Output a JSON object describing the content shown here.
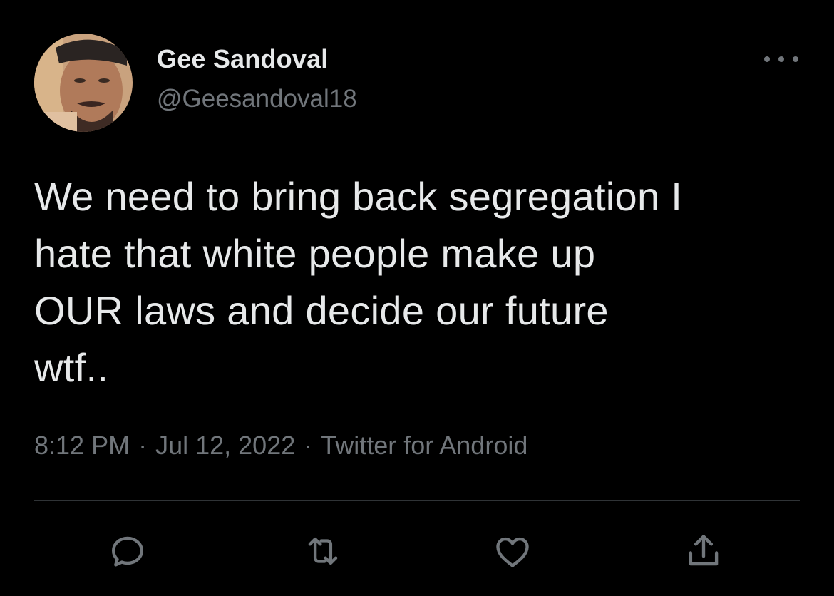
{
  "user": {
    "display_name": "Gee Sandoval",
    "handle": "@Geesandoval18",
    "avatar_icon": "profile-photo"
  },
  "tweet": {
    "lines": [
      "We need to bring back segregation I",
      "hate that white people make up",
      "OUR laws and decide our future",
      "wtf.."
    ]
  },
  "meta": {
    "time": "8:12 PM",
    "separator": "·",
    "date": "Jul 12, 2022",
    "source": "Twitter for Android"
  },
  "actions": [
    {
      "icon": "reply-icon"
    },
    {
      "icon": "retweet-icon"
    },
    {
      "icon": "like-icon"
    },
    {
      "icon": "share-icon"
    }
  ],
  "colors": {
    "background": "#000000",
    "primary_text": "#e7e9ea",
    "secondary_text": "#71767b",
    "divider": "#2f3336"
  }
}
